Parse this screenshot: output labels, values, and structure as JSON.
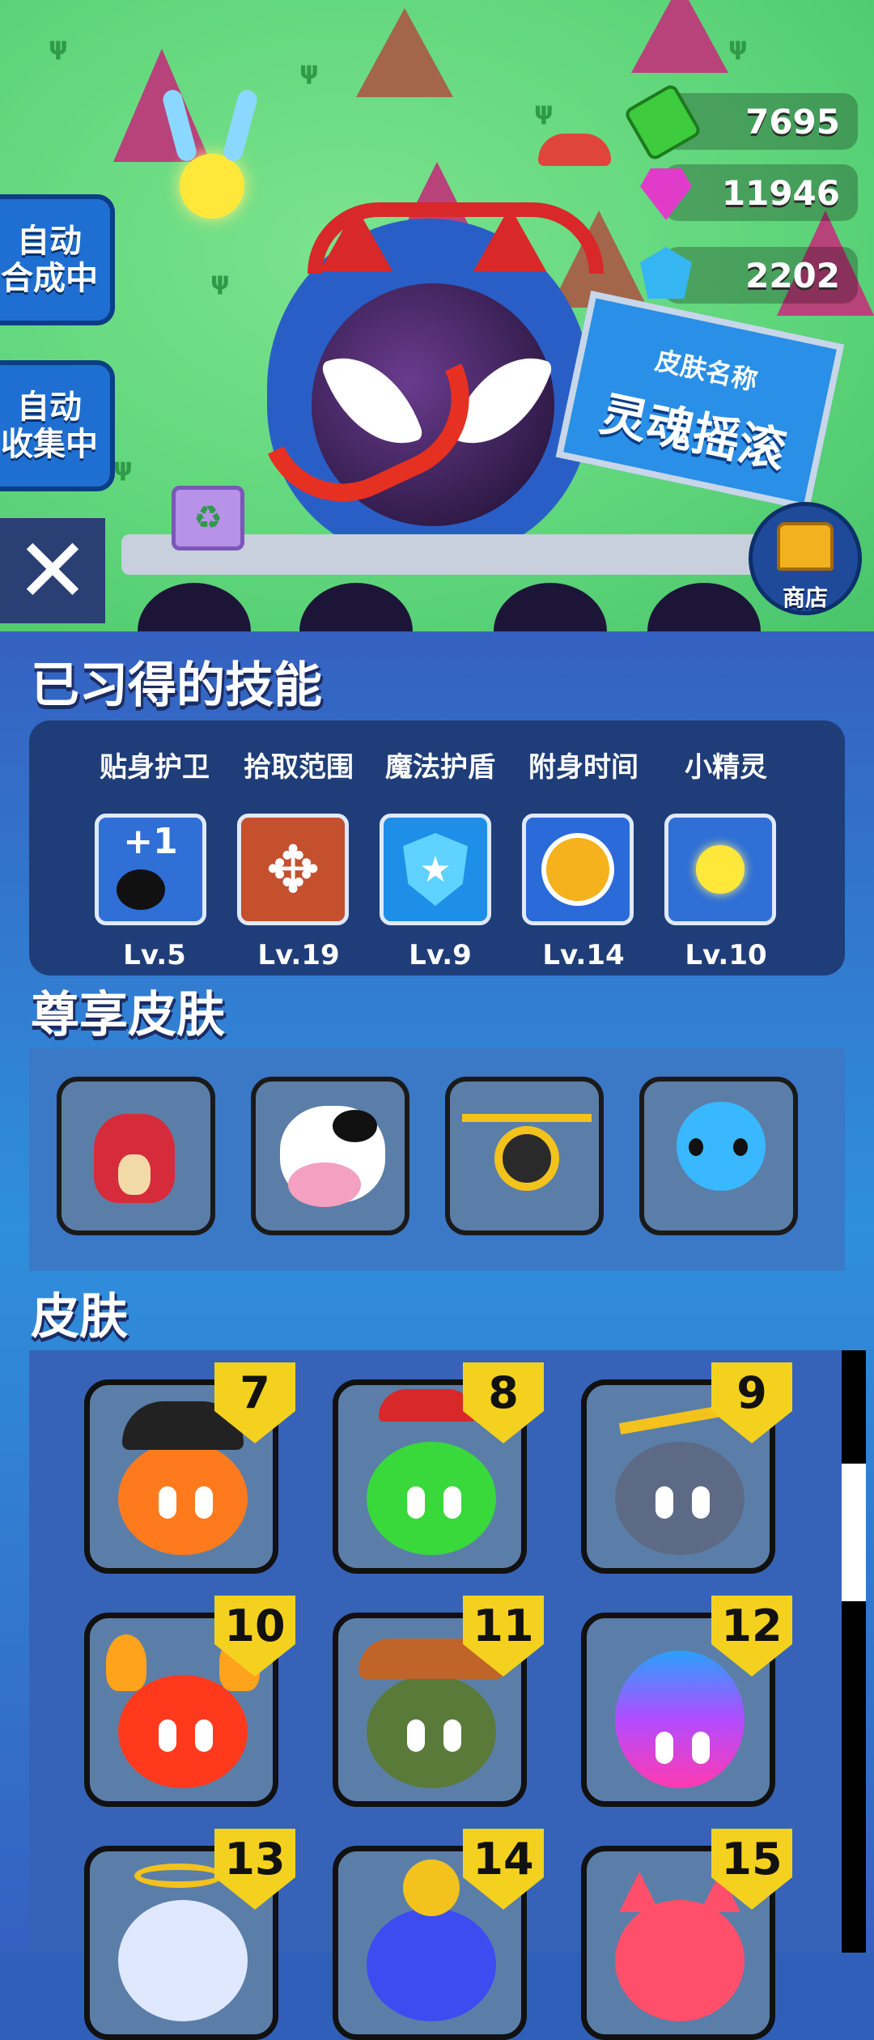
{
  "hud": {
    "currencies": [
      {
        "icon": "green-cash-icon",
        "value": "7695",
        "color": "#3ecb3e"
      },
      {
        "icon": "pink-gem-icon",
        "value": "11946",
        "color": "#e13cc9"
      },
      {
        "icon": "blue-crystal-icon",
        "value": "2202",
        "color": "#35b6f2"
      }
    ],
    "auto_merge_label": "自动\n合成中",
    "auto_collect_label": "自动\n收集中",
    "shop_label": "商店",
    "close_icon": "close-icon",
    "skin_sign": {
      "title": "皮肤名称",
      "name": "灵魂摇滚"
    }
  },
  "skills": {
    "title": "已习得的技能",
    "items": [
      {
        "name": "贴身护卫",
        "level": "Lv.5",
        "icon": "plus-one-bomb-icon",
        "badge": "+1"
      },
      {
        "name": "拾取范围",
        "level": "Lv.19",
        "icon": "expand-arrows-icon"
      },
      {
        "name": "魔法护盾",
        "level": "Lv.9",
        "icon": "star-shield-icon"
      },
      {
        "name": "附身时间",
        "level": "Lv.14",
        "icon": "stopwatch-icon"
      },
      {
        "name": "小精灵",
        "level": "Lv.10",
        "icon": "fairy-icon"
      }
    ]
  },
  "vip_skins": {
    "title": "尊享皮肤",
    "items": [
      {
        "icon": "red-dragon-icon"
      },
      {
        "icon": "cow-icon"
      },
      {
        "icon": "drone-icon"
      },
      {
        "icon": "blue-octopus-icon"
      }
    ]
  },
  "skins": {
    "title": "皮肤",
    "items": [
      {
        "number": "7",
        "icon": "pirate-blob-icon",
        "color": "#ff7a1c"
      },
      {
        "number": "8",
        "icon": "mushroom-blob-icon",
        "color": "#39d93c"
      },
      {
        "number": "9",
        "icon": "axe-blob-icon",
        "color": "#5d6a86"
      },
      {
        "number": "10",
        "icon": "fire-blob-icon",
        "color": "#ff3a1c"
      },
      {
        "number": "11",
        "icon": "cowboy-blob-icon",
        "color": "#5a7a3a"
      },
      {
        "number": "12",
        "icon": "knight-blob-icon",
        "color": "#5b4cff"
      },
      {
        "number": "13",
        "icon": "angel-blob-icon",
        "color": "#dfe8ff"
      },
      {
        "number": "14",
        "icon": "duck-blob-icon",
        "color": "#3c4cf0"
      },
      {
        "number": "15",
        "icon": "devil-blob-icon",
        "color": "#ff4f6a"
      }
    ]
  }
}
